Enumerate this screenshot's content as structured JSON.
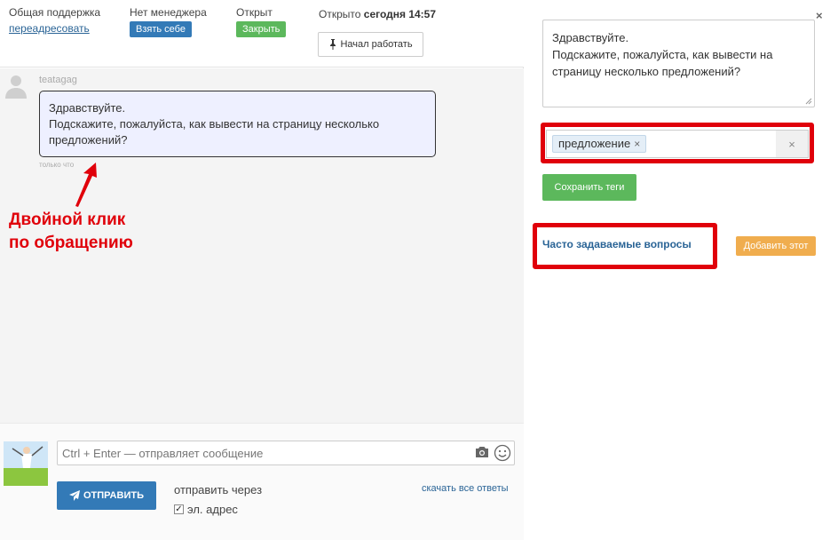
{
  "header": {
    "support": {
      "label": "Общая поддержка",
      "link": "переадресовать"
    },
    "manager": {
      "label": "Нет менеджера",
      "button": "Взять себе"
    },
    "status": {
      "label": "Открыт",
      "button": "Закрыть"
    },
    "opened": {
      "prefix": "Открыто",
      "time": "сегодня 14:57"
    },
    "start_button": "Начал работать"
  },
  "message": {
    "author": "teatagag",
    "lines": [
      "Здравствуйте.",
      "Подскажите, пожалуйста, как вывести на страницу несколько",
      "предложений?"
    ],
    "time": "только что"
  },
  "annotation": {
    "line1": "Двойной клик",
    "line2": "по обращению",
    "color": "#e0000a"
  },
  "composer": {
    "placeholder": "Ctrl + Enter — отправляет сообщение",
    "send_button": "ОТПРАВИТЬ",
    "send_via": "отправить через",
    "channel": "эл. адрес",
    "channel_checked": true,
    "download_link": "скачать все ответы"
  },
  "sidebar": {
    "close": "×",
    "question_lines": [
      "Здравствуйте.",
      "Подскажите, пожалуйста, как вывести на",
      "страницу несколько предложений?"
    ],
    "tags": [
      {
        "label": "предложение",
        "remove": "×"
      }
    ],
    "clear": "×",
    "save_tags": "Сохранить теги",
    "faq_link": "Часто задаваемые вопросы",
    "add_this": "Добавить этот"
  },
  "colors": {
    "primary": "#337ab7",
    "success": "#5cb85c",
    "warning": "#f0ad4e",
    "highlight": "#e0000a"
  }
}
